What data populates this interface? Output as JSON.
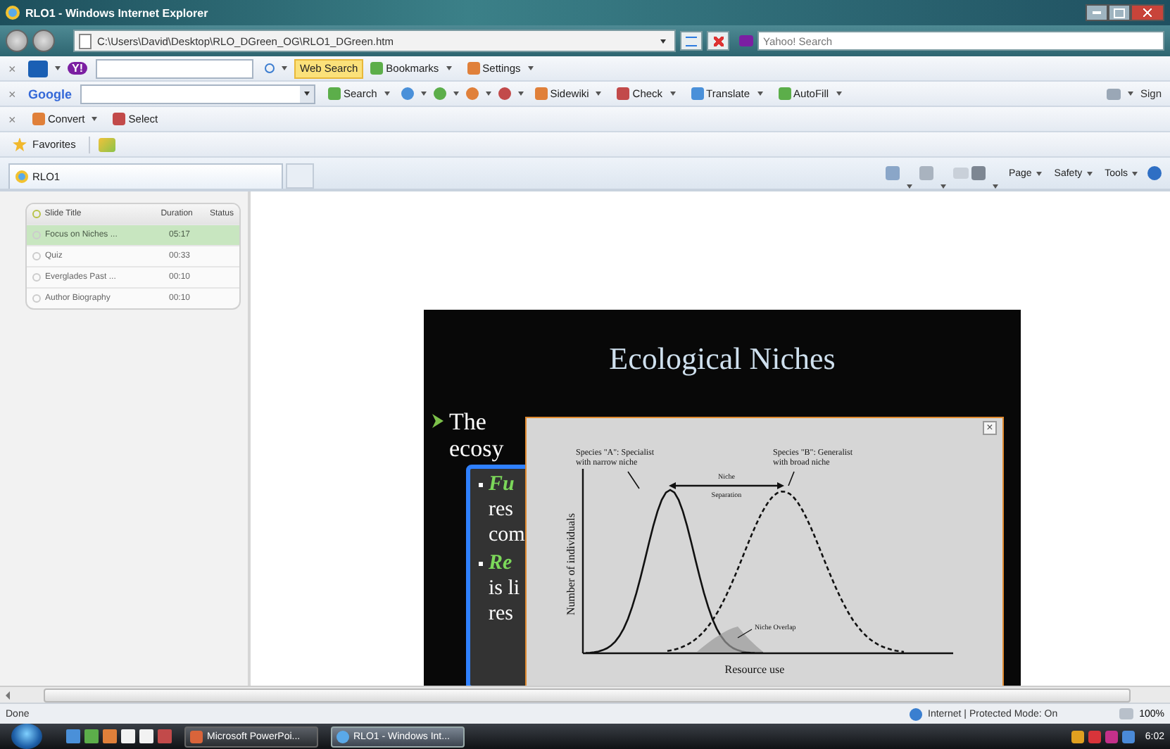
{
  "window": {
    "title": "RLO1 - Windows Internet Explorer"
  },
  "address_bar": {
    "url": "C:\\Users\\David\\Desktop\\RLO_DGreen_OG\\RLO1_DGreen.htm"
  },
  "search_box": {
    "placeholder": "Yahoo! Search"
  },
  "toolbars": [
    {
      "close": "×",
      "logo": "Y!",
      "buttons": [
        {
          "label": "Web Search",
          "menu": false,
          "highlighted": true
        },
        {
          "label": "Bookmarks",
          "menu": true,
          "highlighted": false
        },
        {
          "label": "Settings",
          "menu": true,
          "highlighted": false
        }
      ]
    },
    {
      "close": "×",
      "logo": "Google",
      "buttons": [
        {
          "label": "Search",
          "menu": true,
          "highlighted": false
        },
        {
          "label": "Sidewiki",
          "menu": true,
          "highlighted": false
        },
        {
          "label": "Check",
          "menu": true,
          "highlighted": false
        },
        {
          "label": "Translate",
          "menu": true,
          "highlighted": false
        },
        {
          "label": "AutoFill",
          "menu": true,
          "highlighted": false
        }
      ],
      "right_label": "Sign"
    },
    {
      "close": "×",
      "buttons": [
        {
          "label": "Convert",
          "menu": true,
          "highlighted": false
        },
        {
          "label": "Select",
          "menu": false,
          "highlighted": false
        }
      ]
    }
  ],
  "favorites_bar": {
    "label": "Favorites"
  },
  "tabs": [
    {
      "label": "RLO1",
      "selected": true
    }
  ],
  "command_bar": [
    {
      "label": "Page"
    },
    {
      "label": "Safety"
    },
    {
      "label": "Tools"
    }
  ],
  "slide_list": {
    "columns": [
      "Slide Title",
      "Duration",
      "Status"
    ],
    "rows": [
      {
        "title": "Focus on Niches ...",
        "duration": "05:17",
        "selected": true
      },
      {
        "title": "Quiz",
        "duration": "00:33",
        "selected": false
      },
      {
        "title": "Everglades Past ...",
        "duration": "00:10",
        "selected": false
      },
      {
        "title": "Author Biography",
        "duration": "00:10",
        "selected": false
      }
    ]
  },
  "slide": {
    "title": "Ecological Niches",
    "bullet_lines": [
      "The",
      "ecosy"
    ],
    "sub_bullets": [
      {
        "lines": [
          "Fu",
          "res",
          "com"
        ]
      },
      {
        "lines": [
          "Re",
          "is li",
          "res"
        ]
      }
    ]
  },
  "figure_popup": {
    "close": "×",
    "species_a": "Species \"A\": Specialist",
    "species_a_note": "with narrow niche",
    "species_b": "Species \"B\": Generalist",
    "species_b_note": "with broad niche",
    "separation_top": "Niche",
    "separation_bottom": "Separation",
    "overlap": "Niche Overlap",
    "ylabel": "Number of individuals",
    "xlabel": "Resource use"
  },
  "status_bar": {
    "text": "Done",
    "zone": "Internet | Protected Mode: On",
    "zoom": "100%"
  },
  "taskbar": {
    "tasks": [
      {
        "label": "Microsoft PowerPoi...",
        "selected": false
      },
      {
        "label": "RLO1 - Windows Int...",
        "selected": true
      }
    ],
    "clock": "6:02"
  }
}
